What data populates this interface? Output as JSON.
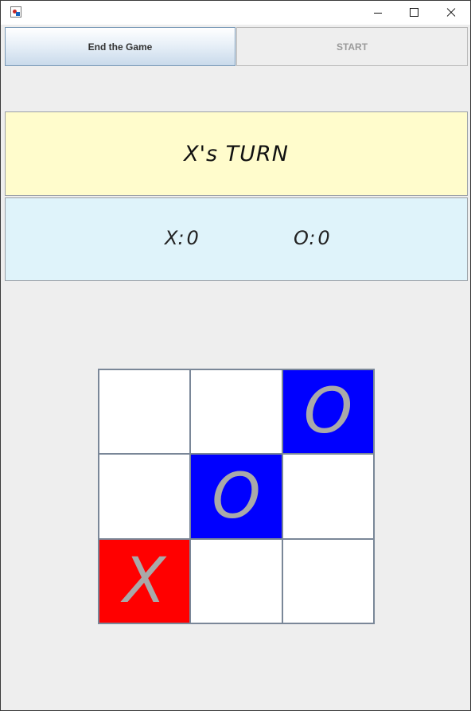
{
  "window": {
    "icon": "java-icon"
  },
  "controls": {
    "end_label": "End the Game",
    "start_label": "START"
  },
  "status": {
    "turn_text": "X's TURN"
  },
  "scores": {
    "x_label": "X:",
    "x_value": "0",
    "o_label": "O:",
    "o_value": "0"
  },
  "board": {
    "cells": [
      "",
      "",
      "O",
      "",
      "O",
      "",
      "X",
      "",
      ""
    ]
  },
  "colors": {
    "x_cell": "#ff0000",
    "o_cell": "#0000ff",
    "empty_cell": "#ffffff",
    "mark": "#a9a9a9"
  }
}
